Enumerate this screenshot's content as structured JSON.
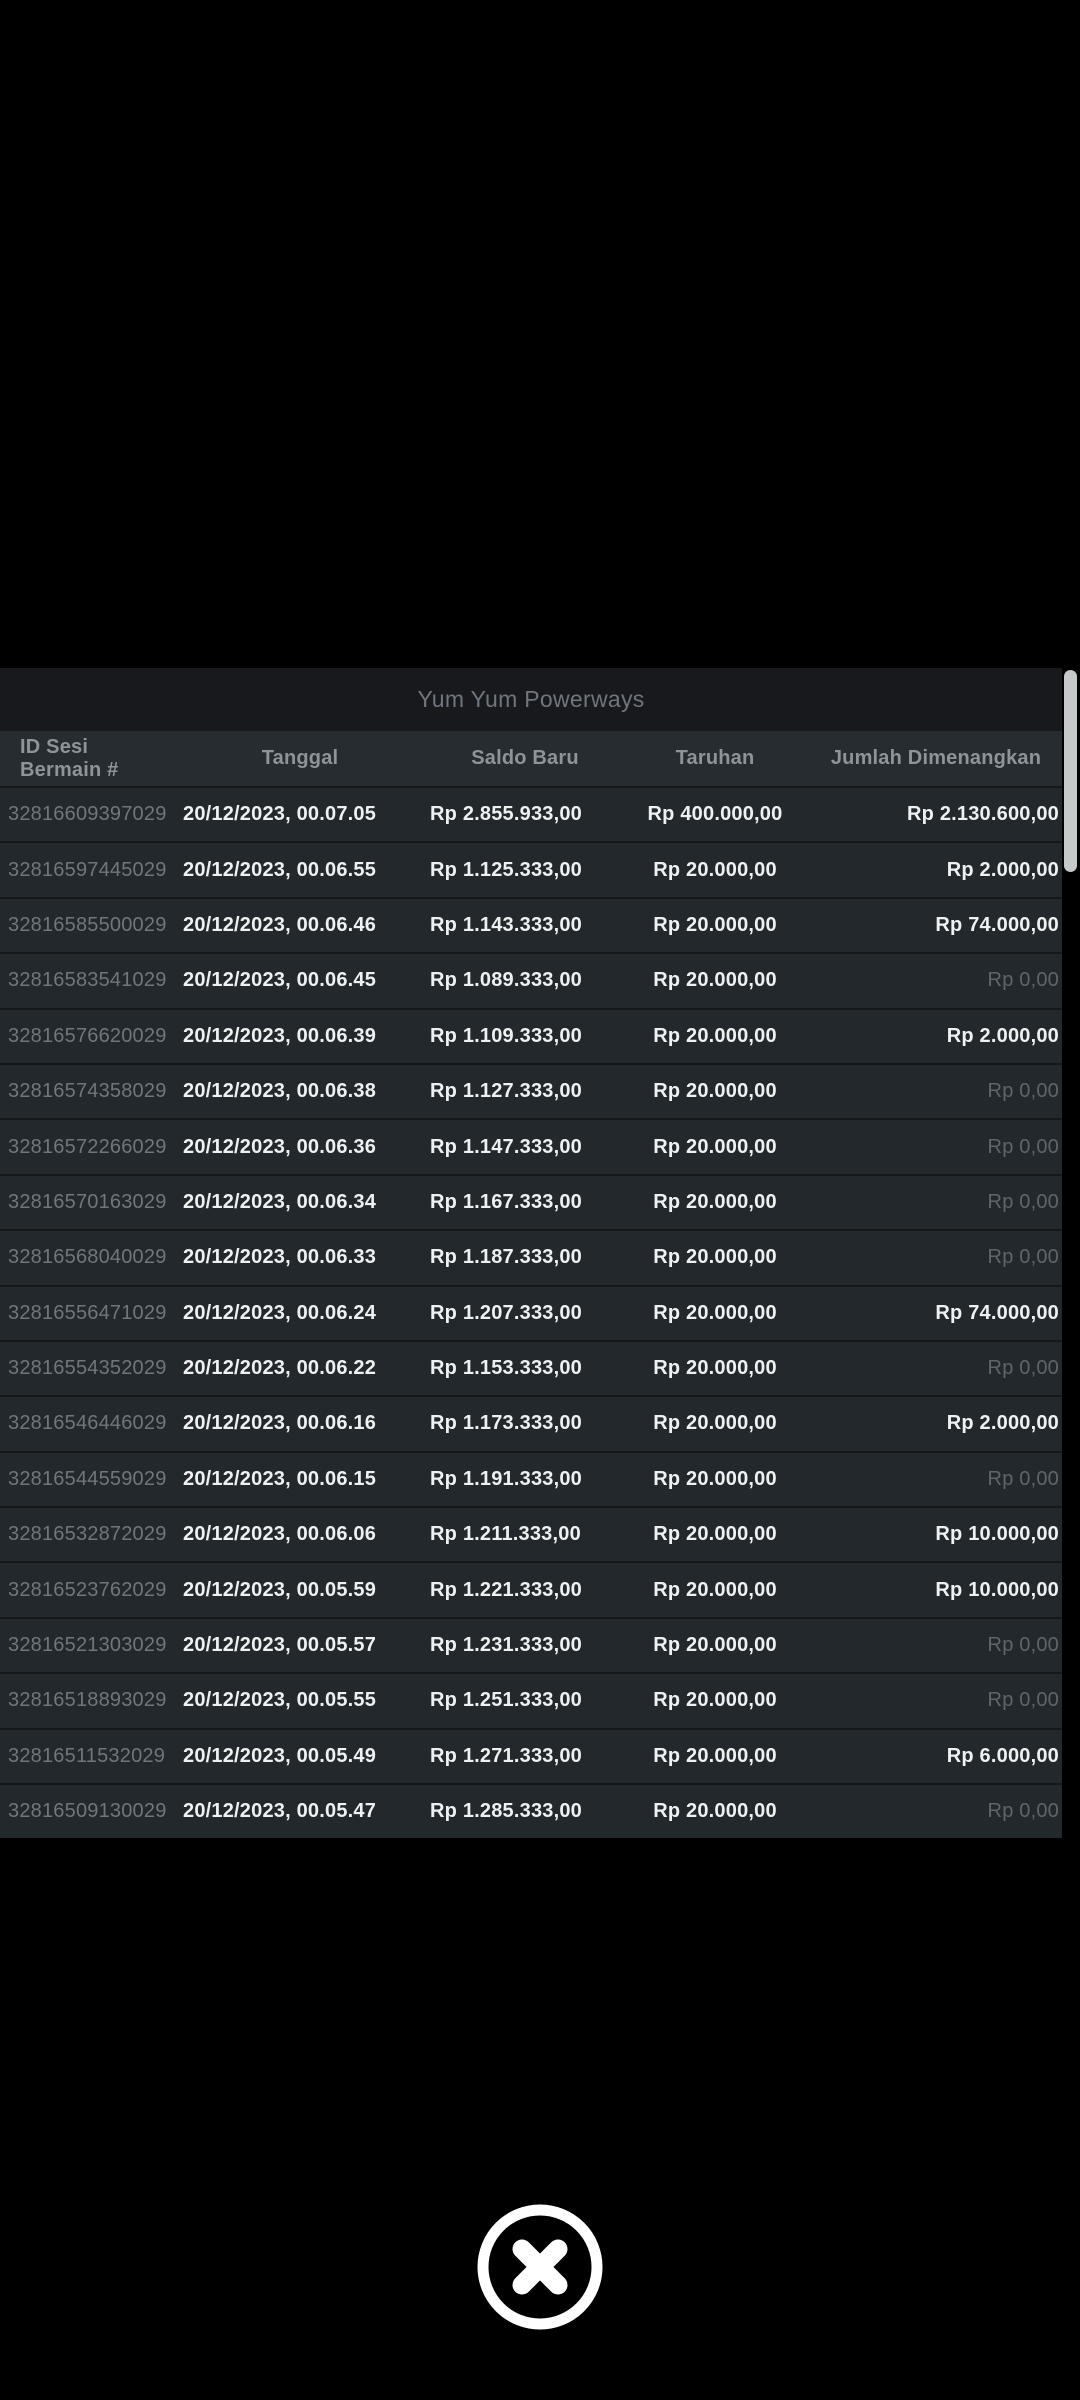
{
  "modal": {
    "title": "Yum Yum Powerways",
    "columns": [
      "ID Sesi Bermain #",
      "Tanggal",
      "Saldo Baru",
      "Taruhan",
      "Jumlah Dimenangkan"
    ],
    "rows": [
      {
        "id": "32816609397029",
        "date": "20/12/2023, 00.07.05",
        "balance": "Rp 2.855.933,00",
        "bet": "Rp 400.000,00",
        "win": "Rp 2.130.600,00"
      },
      {
        "id": "32816597445029",
        "date": "20/12/2023, 00.06.55",
        "balance": "Rp 1.125.333,00",
        "bet": "Rp 20.000,00",
        "win": "Rp 2.000,00"
      },
      {
        "id": "32816585500029",
        "date": "20/12/2023, 00.06.46",
        "balance": "Rp 1.143.333,00",
        "bet": "Rp 20.000,00",
        "win": "Rp 74.000,00"
      },
      {
        "id": "32816583541029",
        "date": "20/12/2023, 00.06.45",
        "balance": "Rp 1.089.333,00",
        "bet": "Rp 20.000,00",
        "win": "Rp 0,00"
      },
      {
        "id": "32816576620029",
        "date": "20/12/2023, 00.06.39",
        "balance": "Rp 1.109.333,00",
        "bet": "Rp 20.000,00",
        "win": "Rp 2.000,00"
      },
      {
        "id": "32816574358029",
        "date": "20/12/2023, 00.06.38",
        "balance": "Rp 1.127.333,00",
        "bet": "Rp 20.000,00",
        "win": "Rp 0,00"
      },
      {
        "id": "32816572266029",
        "date": "20/12/2023, 00.06.36",
        "balance": "Rp 1.147.333,00",
        "bet": "Rp 20.000,00",
        "win": "Rp 0,00"
      },
      {
        "id": "32816570163029",
        "date": "20/12/2023, 00.06.34",
        "balance": "Rp 1.167.333,00",
        "bet": "Rp 20.000,00",
        "win": "Rp 0,00"
      },
      {
        "id": "32816568040029",
        "date": "20/12/2023, 00.06.33",
        "balance": "Rp 1.187.333,00",
        "bet": "Rp 20.000,00",
        "win": "Rp 0,00"
      },
      {
        "id": "32816556471029",
        "date": "20/12/2023, 00.06.24",
        "balance": "Rp 1.207.333,00",
        "bet": "Rp 20.000,00",
        "win": "Rp 74.000,00"
      },
      {
        "id": "32816554352029",
        "date": "20/12/2023, 00.06.22",
        "balance": "Rp 1.153.333,00",
        "bet": "Rp 20.000,00",
        "win": "Rp 0,00"
      },
      {
        "id": "32816546446029",
        "date": "20/12/2023, 00.06.16",
        "balance": "Rp 1.173.333,00",
        "bet": "Rp 20.000,00",
        "win": "Rp 2.000,00"
      },
      {
        "id": "32816544559029",
        "date": "20/12/2023, 00.06.15",
        "balance": "Rp 1.191.333,00",
        "bet": "Rp 20.000,00",
        "win": "Rp 0,00"
      },
      {
        "id": "32816532872029",
        "date": "20/12/2023, 00.06.06",
        "balance": "Rp 1.211.333,00",
        "bet": "Rp 20.000,00",
        "win": "Rp 10.000,00"
      },
      {
        "id": "32816523762029",
        "date": "20/12/2023, 00.05.59",
        "balance": "Rp 1.221.333,00",
        "bet": "Rp 20.000,00",
        "win": "Rp 10.000,00"
      },
      {
        "id": "32816521303029",
        "date": "20/12/2023, 00.05.57",
        "balance": "Rp 1.231.333,00",
        "bet": "Rp 20.000,00",
        "win": "Rp 0,00"
      },
      {
        "id": "32816518893029",
        "date": "20/12/2023, 00.05.55",
        "balance": "Rp 1.251.333,00",
        "bet": "Rp 20.000,00",
        "win": "Rp 0,00"
      },
      {
        "id": "32816511532029",
        "date": "20/12/2023, 00.05.49",
        "balance": "Rp 1.271.333,00",
        "bet": "Rp 20.000,00",
        "win": "Rp 6.000,00"
      },
      {
        "id": "32816509130029",
        "date": "20/12/2023, 00.05.47",
        "balance": "Rp 1.285.333,00",
        "bet": "Rp 20.000,00",
        "win": "Rp 0,00"
      }
    ],
    "zero_win_value": "Rp 0,00"
  },
  "close_button": {
    "icon": "close-x-circle-icon"
  },
  "colors": {
    "page_bg": "#000000",
    "titlebar_bg": "#17191c",
    "header_bg": "#262c2f",
    "row_bg": "#22282b",
    "row_divider": "#15181b",
    "bright_text": "#eef0f1",
    "muted_text": "#70777c",
    "zero_text": "#5f666b",
    "scrollbar_thumb": "#c6c9c9"
  }
}
